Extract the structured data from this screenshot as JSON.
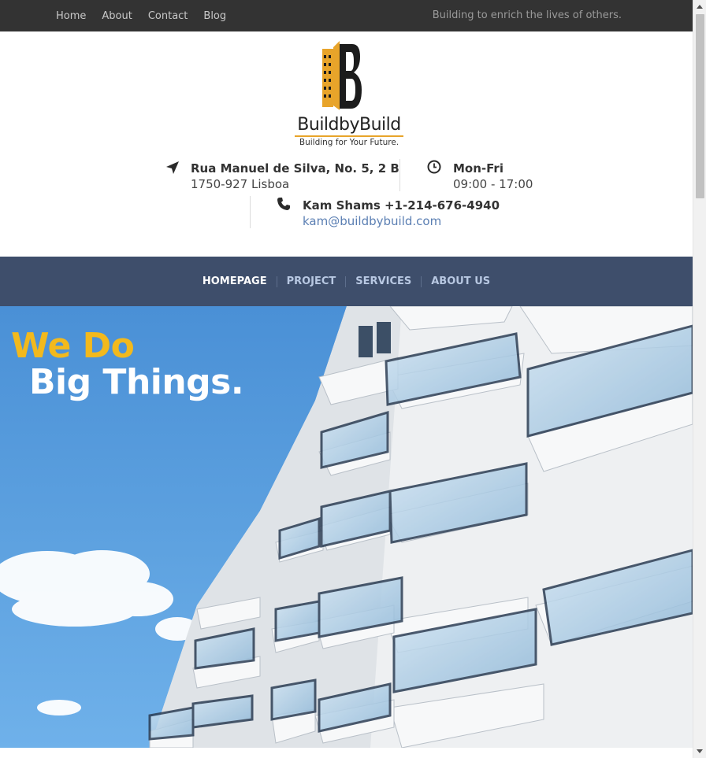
{
  "topbar": {
    "nav": [
      "Home",
      "About",
      "Contact",
      "Blog"
    ],
    "tagline": "Building to enrich the lives of others."
  },
  "logo": {
    "name": "BuildbyBuild",
    "subtitle": "Building for Your Future."
  },
  "contact": {
    "address_title": "Rua Manuel de Silva, No. 5, 2 B",
    "address_line": "1750-927 Lisboa",
    "hours_title": "Mon-Fri",
    "hours_line": "09:00 - 17:00",
    "phone_title": "Kam Shams +1-214-676-4940",
    "email": "kam@buildbybuild.com"
  },
  "mainnav": {
    "items": [
      "HOMEPAGE",
      "PROJECT",
      "SERVICES",
      "ABOUT US"
    ],
    "active": "HOMEPAGE"
  },
  "hero": {
    "line1": "We Do",
    "line2": "Big Things."
  },
  "icons": {
    "address": "location-arrow-icon",
    "hours": "clock-icon",
    "phone": "phone-icon"
  },
  "colors": {
    "topbar": "#333333",
    "nav": "#3e4e6b",
    "accent": "#f2b91d",
    "link": "#5b7fb3"
  }
}
